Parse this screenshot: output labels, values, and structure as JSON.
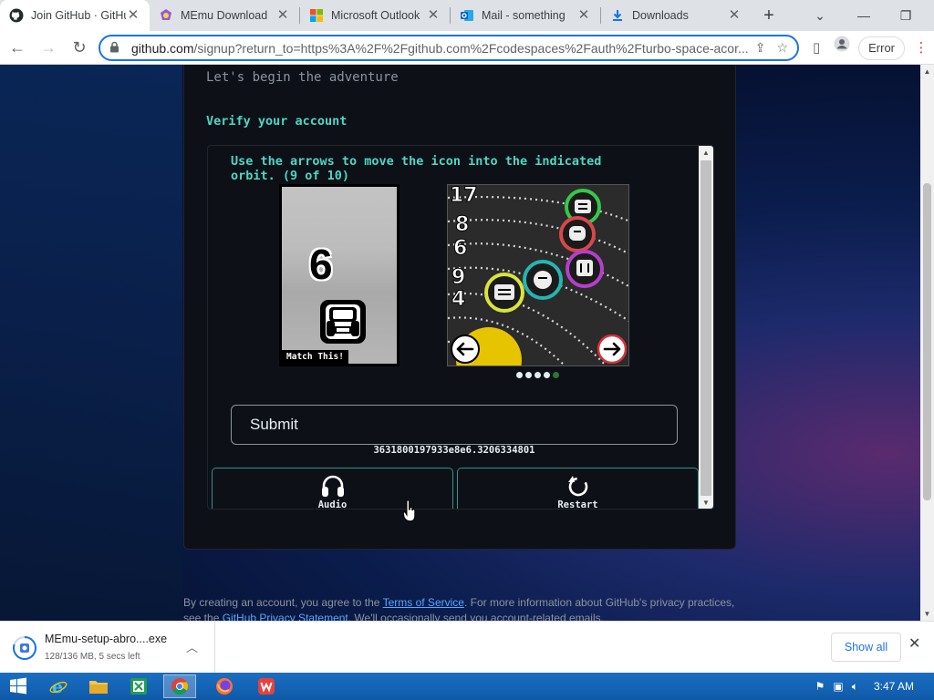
{
  "tabs": [
    {
      "title": "Join GitHub · GitHub",
      "active": true,
      "favicon": "github-icon"
    },
    {
      "title": "MEmu Download",
      "active": false,
      "favicon": "memu-icon"
    },
    {
      "title": "Microsoft Outlook",
      "active": false,
      "favicon": "microsoft-icon"
    },
    {
      "title": "Mail - something",
      "active": false,
      "favicon": "outlook-icon"
    },
    {
      "title": "Downloads",
      "active": false,
      "favicon": "download-icon"
    }
  ],
  "toolbar": {
    "url_host": "github.com",
    "url_rest": "/signup?return_to=https%3A%2F%2Fgithub.com%2Fcodespaces%2Fauth%2Fturbo-space-acor...",
    "error_label": "Error"
  },
  "page": {
    "tagline": "Let's begin the adventure",
    "verify_title": "Verify your account",
    "captcha": {
      "instruction": "Use the arrows to move the icon into the indicated orbit. (9 of 10)",
      "match_number": "6",
      "match_label": "Match This!",
      "orbit_numbers": [
        "17",
        "8",
        "6",
        "9",
        "4"
      ],
      "submit_label": "Submit",
      "session_id": "3631800197933e8e6.3206334801",
      "audio_label": "Audio",
      "restart_label": "Restart",
      "progress_dots": 5,
      "progress_current": 5
    },
    "legal": {
      "before": "By creating an account, you agree to the ",
      "tos_link": "Terms of Service",
      "middle": ". For more information about GitHub's privacy practices, see the ",
      "privacy_link": "GitHub Privacy Statement",
      "after": ". We'll occasionally send you account-related emails."
    }
  },
  "download": {
    "filename": "MEmu-setup-abro....exe",
    "status": "128/136 MB, 5 secs left",
    "show_all": "Show all"
  },
  "taskbar": {
    "clock": "3:47 AM"
  },
  "colors": {
    "accent_teal": "#4ed6c4",
    "link_blue": "#58a6ff",
    "chrome_blue": "#1a73e8"
  }
}
